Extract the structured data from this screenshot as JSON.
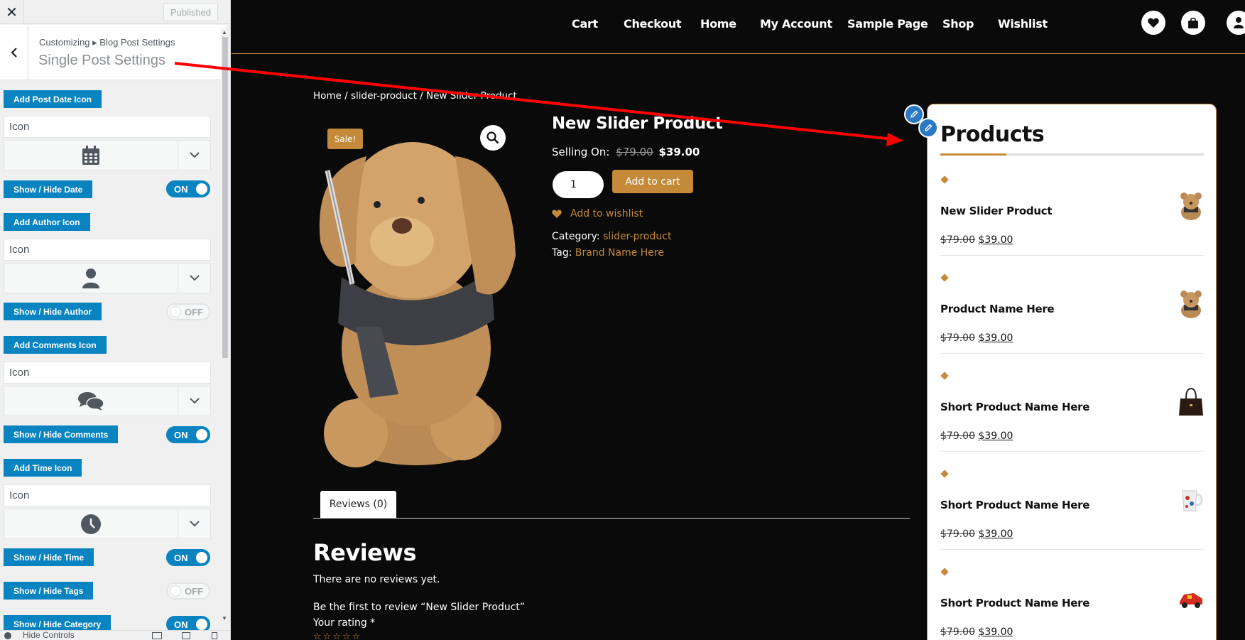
{
  "customizer": {
    "close_label": "✕",
    "publish_label": "Published",
    "back_label": "‹",
    "breadcrumb": "Customizing ▸ Blog Post Settings",
    "title": "Single Post Settings",
    "sections": [
      {
        "label": "Add Post Date Icon",
        "input_value": "Icon",
        "icon": "calendar-icon",
        "toggle_label": "Show / Hide Date",
        "toggle_state": "ON"
      },
      {
        "label": "Add Author Icon",
        "input_value": "Icon",
        "icon": "user-icon",
        "toggle_label": "Show / Hide Author",
        "toggle_state": "OFF"
      },
      {
        "label": "Add Comments Icon",
        "input_value": "Icon",
        "icon": "comments-icon",
        "toggle_label": "Show / Hide Comments",
        "toggle_state": "ON"
      },
      {
        "label": "Add Time Icon",
        "input_value": "Icon",
        "icon": "clock-icon",
        "toggle_label": "Show / Hide Time",
        "toggle_state": "ON"
      }
    ],
    "extra_toggles": [
      {
        "label": "Show / Hide Tags",
        "state": "OFF"
      },
      {
        "label": "Show / Hide Category",
        "state": "ON"
      }
    ],
    "footer_label": "Hide Controls"
  },
  "nav": {
    "links": [
      "Cart",
      "Checkout",
      "Home",
      "My Account",
      "Sample Page",
      "Shop",
      "Wishlist"
    ],
    "icons": [
      "heart-icon",
      "bag-icon",
      "user-icon"
    ]
  },
  "product": {
    "breadcrumb": "Home / slider-product / New Slider Product",
    "sale_badge": "Sale!",
    "title": "New Slider Product",
    "selling_label": "Selling On:",
    "old_price": "$79.00",
    "new_price": "$39.00",
    "qty": "1",
    "add_to_cart": "Add to cart",
    "wishlist": "Add to wishlist",
    "category_label": "Category:",
    "category_value": "slider-product",
    "tag_label": "Tag:",
    "tag_value": "Brand Name Here",
    "tab_label": "Reviews (0)",
    "reviews_heading": "Reviews",
    "no_reviews": "There are no reviews yet.",
    "be_first": "Be the first to review “New Slider Product”",
    "your_rating": "Your rating *",
    "stars": "☆☆☆☆☆"
  },
  "widget": {
    "title": "Products",
    "items": [
      {
        "name": "New Slider Product",
        "old": "$79.00",
        "new": "$39.00",
        "thumb": "teddy-bear"
      },
      {
        "name": "Product Name Here",
        "old": "$79.00",
        "new": "$39.00",
        "thumb": "teddy-bear"
      },
      {
        "name": "Short Product Name Here",
        "old": "$79.00",
        "new": "$39.00",
        "thumb": "handbag"
      },
      {
        "name": "Short Product Name Here",
        "old": "$79.00",
        "new": "$39.00",
        "thumb": "mug"
      },
      {
        "name": "Short Product Name Here",
        "old": "$79.00",
        "new": "$39.00",
        "thumb": "toy-car"
      }
    ]
  },
  "colors": {
    "accent": "#c48a3a",
    "wp_blue": "#0a84c1",
    "arrow": "#ff0000"
  }
}
